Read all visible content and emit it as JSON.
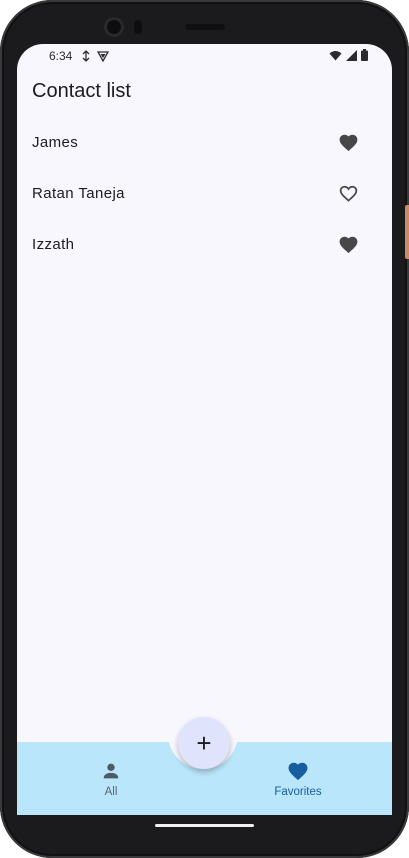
{
  "status_bar": {
    "time": "6:34",
    "icons": [
      "sync-icon",
      "shield-icon",
      "wifi-icon",
      "signal-icon",
      "battery-icon"
    ]
  },
  "page": {
    "title": "Contact list"
  },
  "contacts": [
    {
      "name": "James",
      "favorite": true
    },
    {
      "name": "Ratan Taneja",
      "favorite": false
    },
    {
      "name": "Izzath",
      "favorite": true
    }
  ],
  "fab": {
    "label": "+",
    "icon": "add-icon"
  },
  "bottom_nav": {
    "items": [
      {
        "label": "All",
        "icon": "person-icon",
        "selected": false
      },
      {
        "label": "Favorites",
        "icon": "heart-icon",
        "selected": true
      }
    ]
  },
  "colors": {
    "screen_background": "#f8f7fd",
    "bottom_bar": "#b9e6fa",
    "fab_background": "#dfe3fb",
    "heart": "#474747",
    "favorites_active": "#175ea0"
  }
}
